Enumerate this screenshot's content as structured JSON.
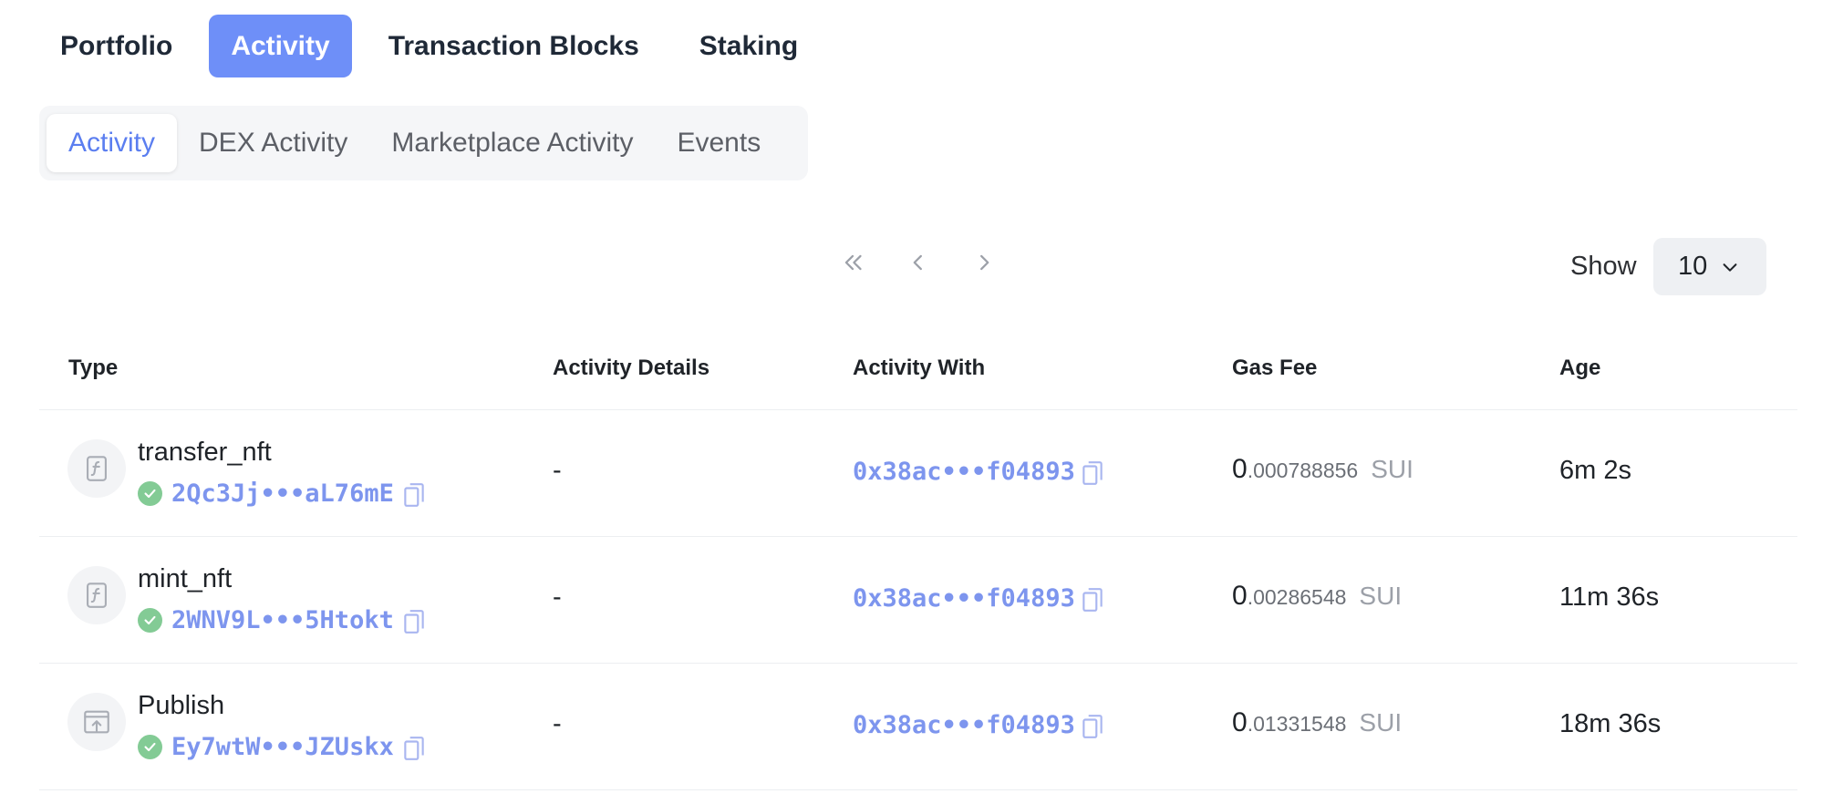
{
  "top_tabs": [
    {
      "label": "Portfolio",
      "active": false
    },
    {
      "label": "Activity",
      "active": true
    },
    {
      "label": "Transaction Blocks",
      "active": false
    },
    {
      "label": "Staking",
      "active": false
    }
  ],
  "sub_tabs": [
    {
      "label": "Activity",
      "active": true
    },
    {
      "label": "DEX Activity",
      "active": false
    },
    {
      "label": "Marketplace Activity",
      "active": false
    },
    {
      "label": "Events",
      "active": false
    }
  ],
  "pagination": {
    "show_label": "Show",
    "page_size": "10",
    "icons": [
      "first-page-icon",
      "prev-page-icon",
      "next-page-icon"
    ]
  },
  "table": {
    "headers": {
      "type": "Type",
      "details": "Activity Details",
      "with": "Activity With",
      "gas": "Gas Fee",
      "age": "Age"
    },
    "rows": [
      {
        "type": "transfer_nft",
        "icon": "function-icon",
        "digest": "2Qc3Jj•••aL76mE",
        "details": "-",
        "with": "0x38ac•••f04893",
        "gas_int": "0",
        "gas_frac": ".000788856",
        "gas_unit": "SUI",
        "age": "6m 2s"
      },
      {
        "type": "mint_nft",
        "icon": "function-icon",
        "digest": "2WNV9L•••5Htokt",
        "details": "-",
        "with": "0x38ac•••f04893",
        "gas_int": "0",
        "gas_frac": ".00286548",
        "gas_unit": "SUI",
        "age": "11m 36s"
      },
      {
        "type": "Publish",
        "icon": "publish-icon",
        "digest": "Ey7wtW•••JZUskx",
        "details": "-",
        "with": "0x38ac•••f04893",
        "gas_int": "0",
        "gas_frac": ".01331548",
        "gas_unit": "SUI",
        "age": "18m 36s"
      }
    ]
  },
  "colors": {
    "accent": "#6e8ff8",
    "link": "#7d95ee",
    "success": "#83cb95"
  }
}
